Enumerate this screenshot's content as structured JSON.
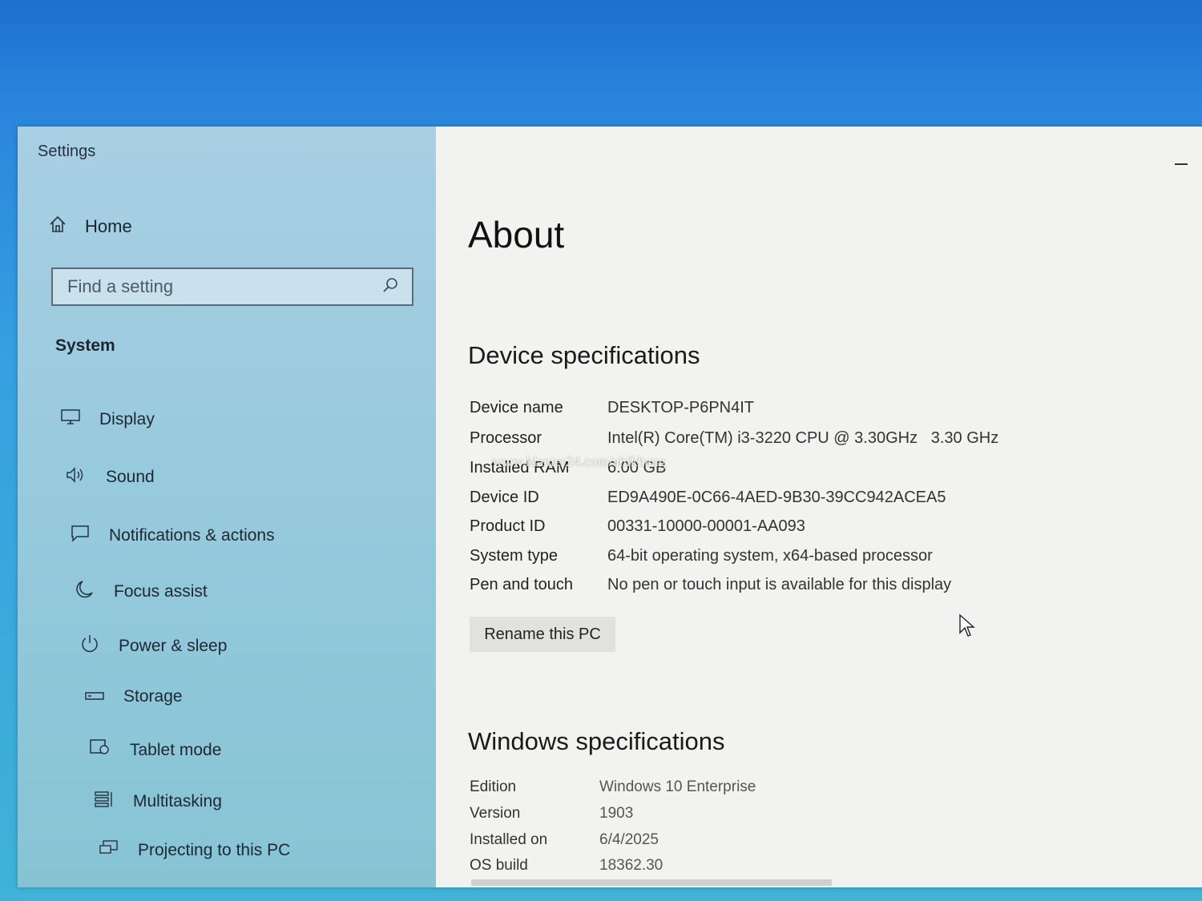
{
  "window": {
    "title": "Settings"
  },
  "sidebar": {
    "home_label": "Home",
    "search_placeholder": "Find a setting",
    "section_label": "System",
    "items": [
      {
        "label": "Display",
        "icon": "monitor-icon"
      },
      {
        "label": "Sound",
        "icon": "speaker-icon"
      },
      {
        "label": "Notifications & actions",
        "icon": "notification-icon"
      },
      {
        "label": "Focus assist",
        "icon": "moon-icon"
      },
      {
        "label": "Power & sleep",
        "icon": "power-icon"
      },
      {
        "label": "Storage",
        "icon": "storage-icon"
      },
      {
        "label": "Tablet mode",
        "icon": "tablet-icon"
      },
      {
        "label": "Multitasking",
        "icon": "multitasking-icon"
      },
      {
        "label": "Projecting to this PC",
        "icon": "projector-icon"
      }
    ]
  },
  "main": {
    "title": "About",
    "device_specs": {
      "heading": "Device specifications",
      "rows": [
        {
          "label": "Device name",
          "value": "DESKTOP-P6PN4IT"
        },
        {
          "label": "Processor",
          "value": "Intel(R) Core(TM) i3-3220 CPU @ 3.30GHz   3.30 GHz"
        },
        {
          "label": "Installed RAM",
          "value": "6.00 GB"
        },
        {
          "label": "Device ID",
          "value": "ED9A490E-0C66-4AED-9B30-39CC942ACEA5"
        },
        {
          "label": "Product ID",
          "value": "00331-10000-00001-AA093"
        },
        {
          "label": "System type",
          "value": "64-bit operating system, x64-based processor"
        },
        {
          "label": "Pen and touch",
          "value": "No pen or touch input is available for this display"
        }
      ],
      "rename_button": "Rename this PC"
    },
    "windows_specs": {
      "heading": "Windows specifications",
      "rows": [
        {
          "label": "Edition",
          "value": "Windows 10 Enterprise"
        },
        {
          "label": "Version",
          "value": "1903"
        },
        {
          "label": "Installed on",
          "value": "6/4/2025"
        },
        {
          "label": "OS build",
          "value": "18362.30"
        }
      ]
    }
  },
  "watermark": "www.klanter24.com/ahikhang"
}
